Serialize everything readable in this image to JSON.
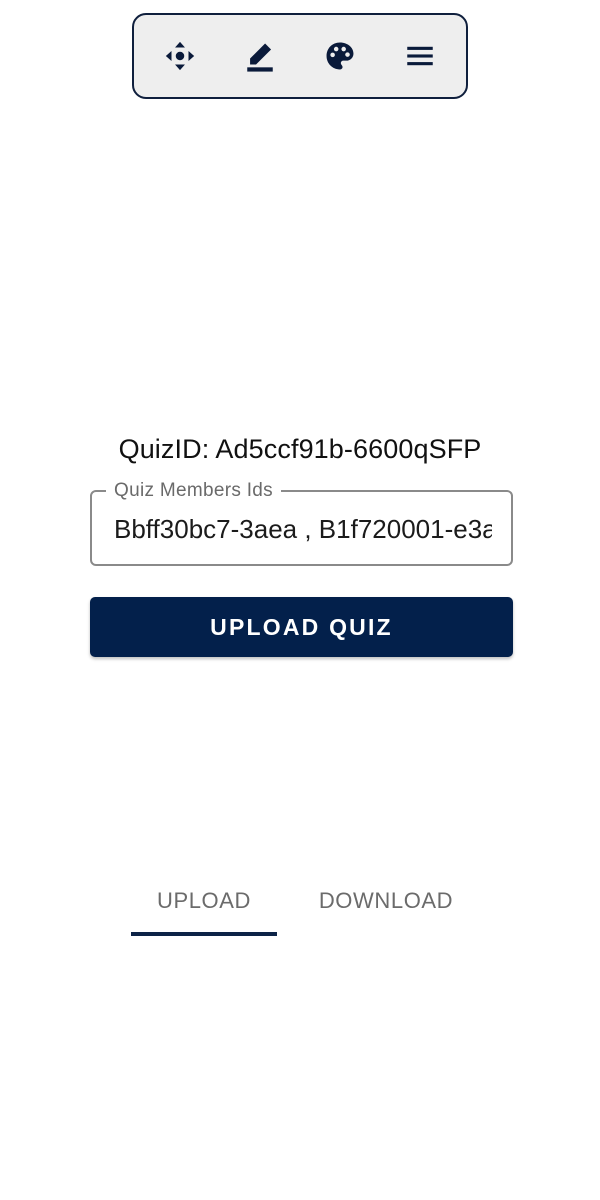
{
  "toolbar": {
    "items": [
      {
        "icon": "move-icon"
      },
      {
        "icon": "edit-icon"
      },
      {
        "icon": "palette-icon"
      },
      {
        "icon": "menu-icon"
      }
    ]
  },
  "quiz": {
    "id_text": "QuizID: Ad5ccf91b-6600qSFP"
  },
  "members_field": {
    "label": "Quiz Members Ids",
    "value": "Bbff30bc7-3aea , B1f720001-e3a"
  },
  "upload_button": {
    "label": "UPLOAD QUIZ"
  },
  "tabs": [
    {
      "label": "UPLOAD",
      "selected": true
    },
    {
      "label": "DOWNLOAD",
      "selected": false
    }
  ],
  "colors": {
    "primary": "#03204b",
    "toolbar_bg": "#eeeeee",
    "toolbar_border": "#0f1f3d",
    "tab_indicator": "#0d2347"
  }
}
